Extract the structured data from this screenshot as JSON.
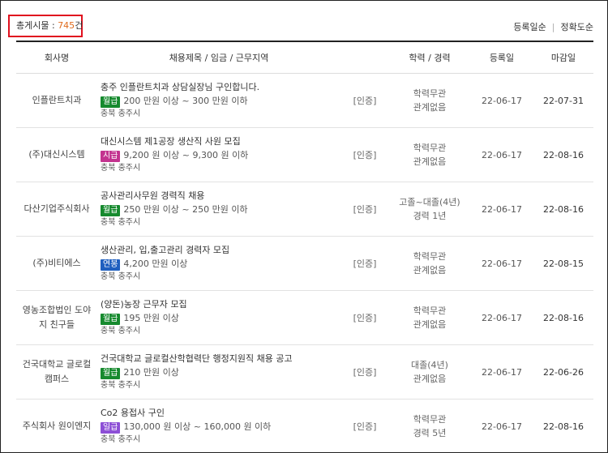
{
  "summary": {
    "label": "총게시물 : ",
    "count": "745",
    "unit": "건"
  },
  "sort": {
    "option1": "등록일순",
    "separator": "|",
    "option2": "정확도순"
  },
  "table": {
    "headers": [
      "회사명",
      "채용제목 / 임금 / 근무지역",
      "학력 / 경력",
      "등록일",
      "마감일"
    ],
    "rows": [
      {
        "company": "인플란트치과",
        "title": "충주 인플란트치과 상담실장님 구인합니다.",
        "pay_type": "월급",
        "pay_color": "#168a2e",
        "pay": "200 만원 이상 ~ 300 만원 이하",
        "location": "충북 충주시",
        "cert": "[인증]",
        "education": "학력무관",
        "experience": "관계없음",
        "registered": "22-06-17",
        "deadline": "22-07-31"
      },
      {
        "company": "(주)대신시스템",
        "title": "대신시스템 제1공장 생산직 사원 모집",
        "pay_type": "시급",
        "pay_color": "#c3338f",
        "pay": "9,200 원 이상 ~ 9,300 원 이하",
        "location": "충북 충주시",
        "cert": "[인증]",
        "education": "학력무관",
        "experience": "관계없음",
        "registered": "22-06-17",
        "deadline": "22-08-16"
      },
      {
        "company": "다산기업주식회사",
        "title": "공사관리사무원 경력직 채용",
        "pay_type": "월급",
        "pay_color": "#168a2e",
        "pay": "250 만원 이상 ~ 250 만원 이하",
        "location": "충북 충주시",
        "cert": "[인증]",
        "education": "고졸~대졸(4년)",
        "experience": "경력 1년",
        "registered": "22-06-17",
        "deadline": "22-08-16"
      },
      {
        "company": "(주)비티에스",
        "title": "생산관리, 입,출고관리 경력자 모집",
        "pay_type": "연봉",
        "pay_color": "#1f5fbf",
        "pay": "4,200 만원 이상",
        "location": "충북 충주시",
        "cert": "[인증]",
        "education": "학력무관",
        "experience": "관계없음",
        "registered": "22-06-17",
        "deadline": "22-08-15"
      },
      {
        "company": "영농조합법인 도야지 친구들",
        "title": "(양돈)농장 근무자 모집",
        "pay_type": "월급",
        "pay_color": "#168a2e",
        "pay": "195 만원 이상",
        "location": "충북 충주시",
        "cert": "[인증]",
        "education": "학력무관",
        "experience": "관계없음",
        "registered": "22-06-17",
        "deadline": "22-08-16"
      },
      {
        "company": "건국대학교 글로컬 캠퍼스",
        "title": "건국대학교 글로컬산학협력단 행정지원직 채용 공고",
        "pay_type": "월급",
        "pay_color": "#168a2e",
        "pay": "210 만원 이상",
        "location": "충북 충주시",
        "cert": "[인증]",
        "education": "대졸(4년)",
        "experience": "관계없음",
        "registered": "22-06-17",
        "deadline": "22-06-26"
      },
      {
        "company": "주식회사 원이엔지",
        "title": "Co2 용접사 구인",
        "pay_type": "일급",
        "pay_color": "#8d4fd6",
        "pay": "130,000 원 이상 ~ 160,000 원 이하",
        "location": "충북 충주시",
        "cert": "[인증]",
        "education": "학력무관",
        "experience": "경력 5년",
        "registered": "22-06-17",
        "deadline": "22-08-16"
      }
    ]
  }
}
